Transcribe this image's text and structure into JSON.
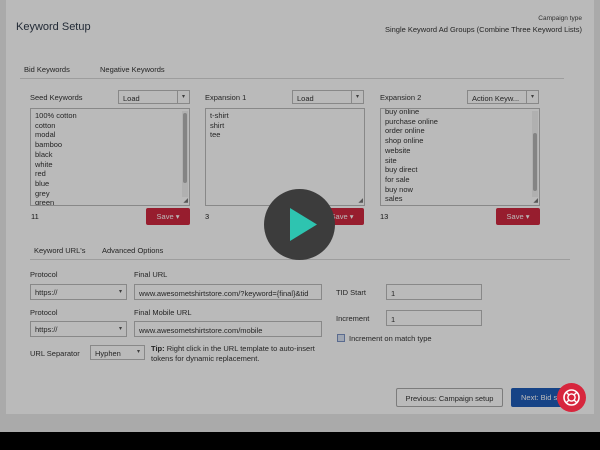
{
  "header": {
    "title": "Keyword Setup",
    "campaign_type_label": "Campaign type",
    "campaign_type_value": "Single Keyword Ad Groups (Combine Three Keyword Lists)"
  },
  "tabs_top": [
    {
      "label": "Bid Keywords",
      "active": true
    },
    {
      "label": "Negative Keywords",
      "active": false
    }
  ],
  "seed": {
    "label": "Seed Keywords",
    "select": "Load",
    "items": [
      "100% cotton",
      "cotton",
      "modal",
      "bamboo",
      "black",
      "white",
      "red",
      "blue",
      "grey",
      "green"
    ],
    "count": "11",
    "save": "Save"
  },
  "expansion1": {
    "label": "Expansion 1",
    "select": "Load",
    "items": [
      "t-shirt",
      "shirt",
      "tee"
    ],
    "count": "3",
    "save": "Save"
  },
  "expansion2": {
    "label": "Expansion 2",
    "select": "Action Keyw...",
    "items": [
      "buy online",
      "purchase online",
      "order online",
      "shop online",
      "website",
      "site",
      "buy direct",
      "for sale",
      "buy now",
      "sales"
    ],
    "count": "13",
    "save": "Save"
  },
  "tabs_bottom": [
    {
      "label": "Keyword URL's",
      "active": true
    },
    {
      "label": "Advanced Options",
      "active": false
    }
  ],
  "url": {
    "protocol_label": "Protocol",
    "protocol_value": "https://",
    "final_url_label": "Final URL",
    "final_url_value": "www.awesometshirtstore.com/?keyword={final}&tid",
    "protocol2_label": "Protocol",
    "protocol2_value": "https://",
    "final_mobile_label": "Final Mobile URL",
    "final_mobile_value": "www.awesometshirtstore.com/mobile",
    "separator_label": "URL Separator",
    "separator_value": "Hyphen",
    "tip_bold": "Tip:",
    "tip_text": " Right click in the URL template to auto-insert tokens for dynamic replacement."
  },
  "tid": {
    "start_label": "TID Start",
    "start_value": "1",
    "increment_label": "Increment",
    "increment_value": "1",
    "checkbox_label": "Increment on match type"
  },
  "footer": {
    "prev_label": "Previous: Campaign setup",
    "next_label": "Next: Bid se"
  },
  "icons": {
    "play": "play-icon",
    "help": "lifebuoy-icon"
  },
  "colors": {
    "save": "#d0293f",
    "primary": "#1f5cb8",
    "play_triangle": "#2ec4b0",
    "help": "#d7263d"
  }
}
